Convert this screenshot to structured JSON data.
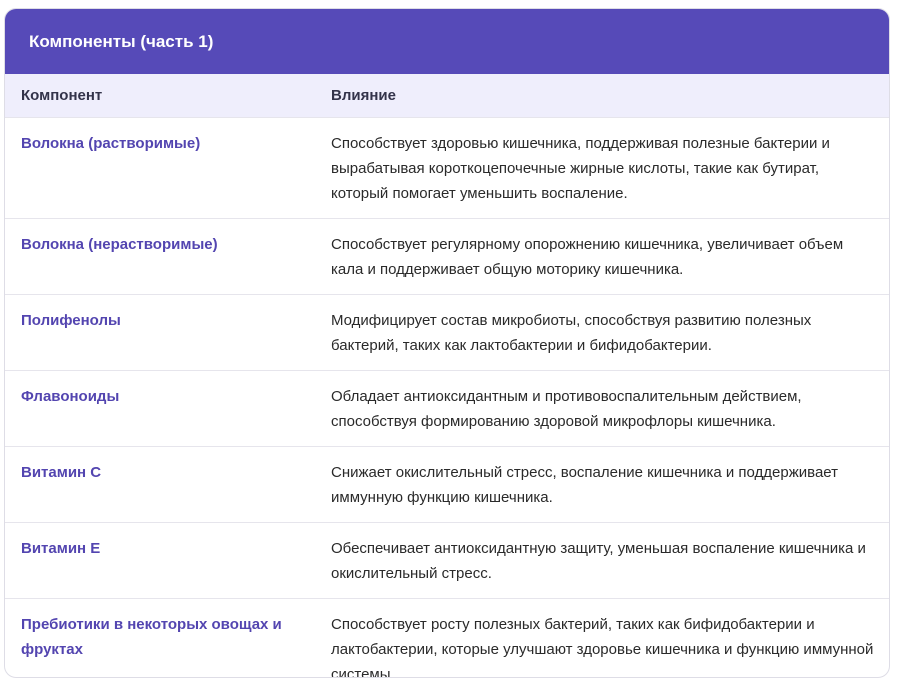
{
  "title": "Компоненты (часть 1)",
  "columns": [
    "Компонент",
    "Влияние"
  ],
  "rows": [
    {
      "component": "Волокна (растворимые)",
      "effect": "Способствует здоровью кишечника, поддерживая полезные бактерии и вырабатывая короткоцепочечные жирные кислоты, такие как бутират, который помогает уменьшить воспаление."
    },
    {
      "component": "Волокна (нерастворимые)",
      "effect": "Способствует регулярному опорожнению кишечника, увеличивает объем кала и поддерживает общую моторику кишечника."
    },
    {
      "component": "Полифенолы",
      "effect": "Модифицирует состав микробиоты, способствуя развитию полезных бактерий, таких как лактобактерии и бифидобактерии."
    },
    {
      "component": "Флавоноиды",
      "effect": "Обладает антиоксидантным и противовоспалительным действием, способствуя формированию здоровой микрофлоры кишечника."
    },
    {
      "component": "Витамин C",
      "effect": "Снижает окислительный стресс, воспаление кишечника и поддерживает иммунную функцию кишечника."
    },
    {
      "component": "Витамин E",
      "effect": "Обеспечивает антиоксидантную защиту, уменьшая воспаление кишечника и окислительный стресс."
    },
    {
      "component": "Пребиотики в некоторых овощах и фруктах",
      "effect": "Способствует росту полезных бактерий, таких как бифидобактерии и лактобактерии, которые улучшают здоровье кишечника и функцию иммунной системы."
    }
  ],
  "colors": {
    "header_bg": "#564ab8",
    "column_header_bg": "#efeefc",
    "component_text": "#5345b0"
  }
}
